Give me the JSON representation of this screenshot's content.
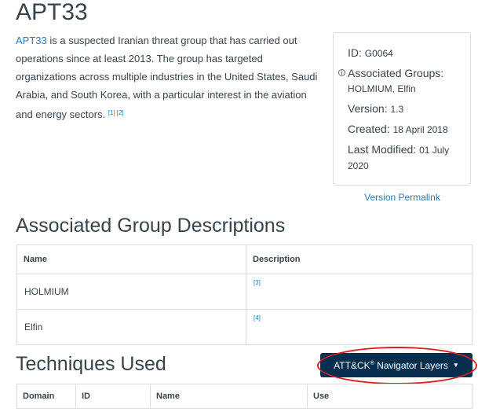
{
  "title": "APT33",
  "description": {
    "lead_link": "APT33",
    "body": " is a suspected Iranian threat group that has carried out operations since at least 2013. The group has targeted organizations across multiple industries in the United States, Saudi Arabia, and South Korea, with a particular interest in the aviation and energy sectors.",
    "refs": [
      "[1]",
      "[2]"
    ]
  },
  "card": {
    "id_label": "ID:",
    "id_value": "G0064",
    "assoc_label": "Associated Groups:",
    "assoc_value": "HOLMIUM, Elfin",
    "version_label": "Version:",
    "version_value": "1.3",
    "created_label": "Created:",
    "created_value": "18 April 2018",
    "modified_label": "Last Modified:",
    "modified_value": "01 July 2020",
    "info_icon": "i"
  },
  "permalink": "Version Permalink",
  "assoc_section": {
    "title": "Associated Group Descriptions",
    "headers": [
      "Name",
      "Description"
    ],
    "rows": [
      {
        "name": "HOLMIUM",
        "ref": "[3]"
      },
      {
        "name": "Elfin",
        "ref": "[4]"
      }
    ]
  },
  "tech_section": {
    "title": "Techniques Used",
    "navigator_button": "ATT&CK",
    "navigator_reg": "®",
    "navigator_suffix": "Navigator Layers",
    "caret": "▼",
    "headers": [
      "Domain",
      "ID",
      "Name",
      "Use"
    ]
  },
  "colors": {
    "link": "#2b7bb9",
    "button_bg": "#062f4f",
    "highlight": "#d62222"
  }
}
